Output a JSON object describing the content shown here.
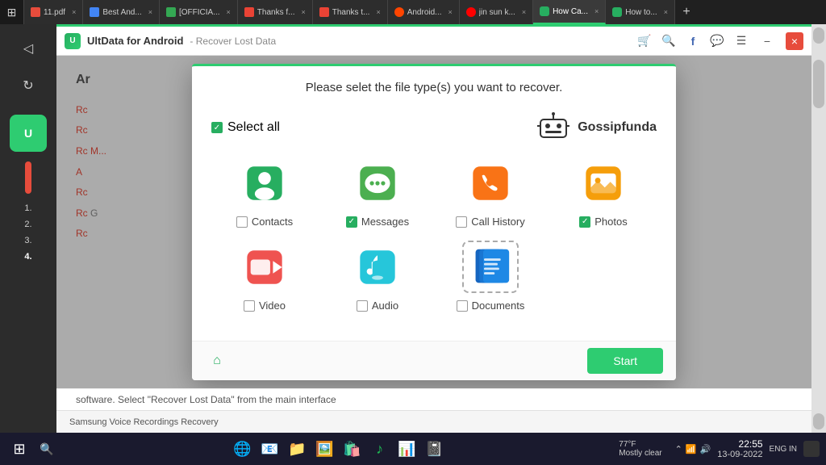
{
  "app": {
    "title": "UltData for Android",
    "subtitle": "- Recover Lost Data",
    "logo_letter": "U"
  },
  "titlebar": {
    "minimize_label": "−",
    "close_label": "×",
    "icons": [
      "🛒",
      "🔍",
      "f",
      "💬",
      "☰"
    ]
  },
  "tabs": [
    {
      "id": "t1",
      "label": "11.pdf",
      "active": false,
      "color": "#e74c3c"
    },
    {
      "id": "t2",
      "label": "Best And...",
      "active": false,
      "color": "#4285f4"
    },
    {
      "id": "t3",
      "label": "[OFFICIA...",
      "active": false,
      "color": "#34a853"
    },
    {
      "id": "t4",
      "label": "Thanks f...",
      "active": false,
      "color": "#ea4335"
    },
    {
      "id": "t5",
      "label": "Thanks t...",
      "active": false,
      "color": "#ea4335"
    },
    {
      "id": "t6",
      "label": "Android...",
      "active": false,
      "color": "#ff0000"
    },
    {
      "id": "t7",
      "label": "jin sun k...",
      "active": false,
      "color": "#ff0000"
    },
    {
      "id": "t8",
      "label": "How Ca...",
      "active": true,
      "color": "#27ae60"
    },
    {
      "id": "t9",
      "label": "How to...",
      "active": false,
      "color": "#27ae60"
    }
  ],
  "modal": {
    "title": "Please selet the file type(s) you want to recover.",
    "select_all_label": "Select all",
    "select_all_checked": true,
    "gossip_logo": "Gossipfunda",
    "file_types": [
      {
        "id": "contacts",
        "label": "Contacts",
        "checked": false,
        "icon_type": "contacts",
        "bg_color": "#27ae60"
      },
      {
        "id": "messages",
        "label": "Messages",
        "checked": true,
        "icon_type": "messages",
        "bg_color": "#4CAF50"
      },
      {
        "id": "call_history",
        "label": "Call History",
        "checked": false,
        "icon_type": "call_history",
        "bg_color": "#F97316"
      },
      {
        "id": "photos",
        "label": "Photos",
        "checked": true,
        "icon_type": "photos",
        "bg_color": "#F59E0B"
      },
      {
        "id": "video",
        "label": "Video",
        "checked": false,
        "icon_type": "video",
        "bg_color": "#ef5350"
      },
      {
        "id": "audio",
        "label": "Audio",
        "checked": false,
        "icon_type": "audio",
        "bg_color": "#26C6DA"
      },
      {
        "id": "documents",
        "label": "Documents",
        "checked": false,
        "icon_type": "documents",
        "bg_color": "#1565C0",
        "selected": true
      }
    ],
    "start_button": "Start",
    "home_icon": "⌂"
  },
  "webpage": {
    "steps": [
      {
        "num": "1.",
        "text": "R..."
      },
      {
        "num": "2.",
        "text": ""
      },
      {
        "num": "3.",
        "text": ""
      },
      {
        "num": "4.",
        "text": ""
      }
    ],
    "footer_text": "software. Select \"Recover Lost Data\" from the main interface",
    "page_title": "Ar..."
  },
  "taskbar_bottom": {
    "weather_temp": "77°F",
    "weather_desc": "Mostly clear",
    "time": "22:55",
    "date": "13-09-2022",
    "locale": "ENG IN",
    "pins": [
      "⊞",
      "🔍",
      "✉",
      "📁",
      "🌐",
      "🛡",
      "📊",
      "🔵",
      "🟣"
    ]
  }
}
